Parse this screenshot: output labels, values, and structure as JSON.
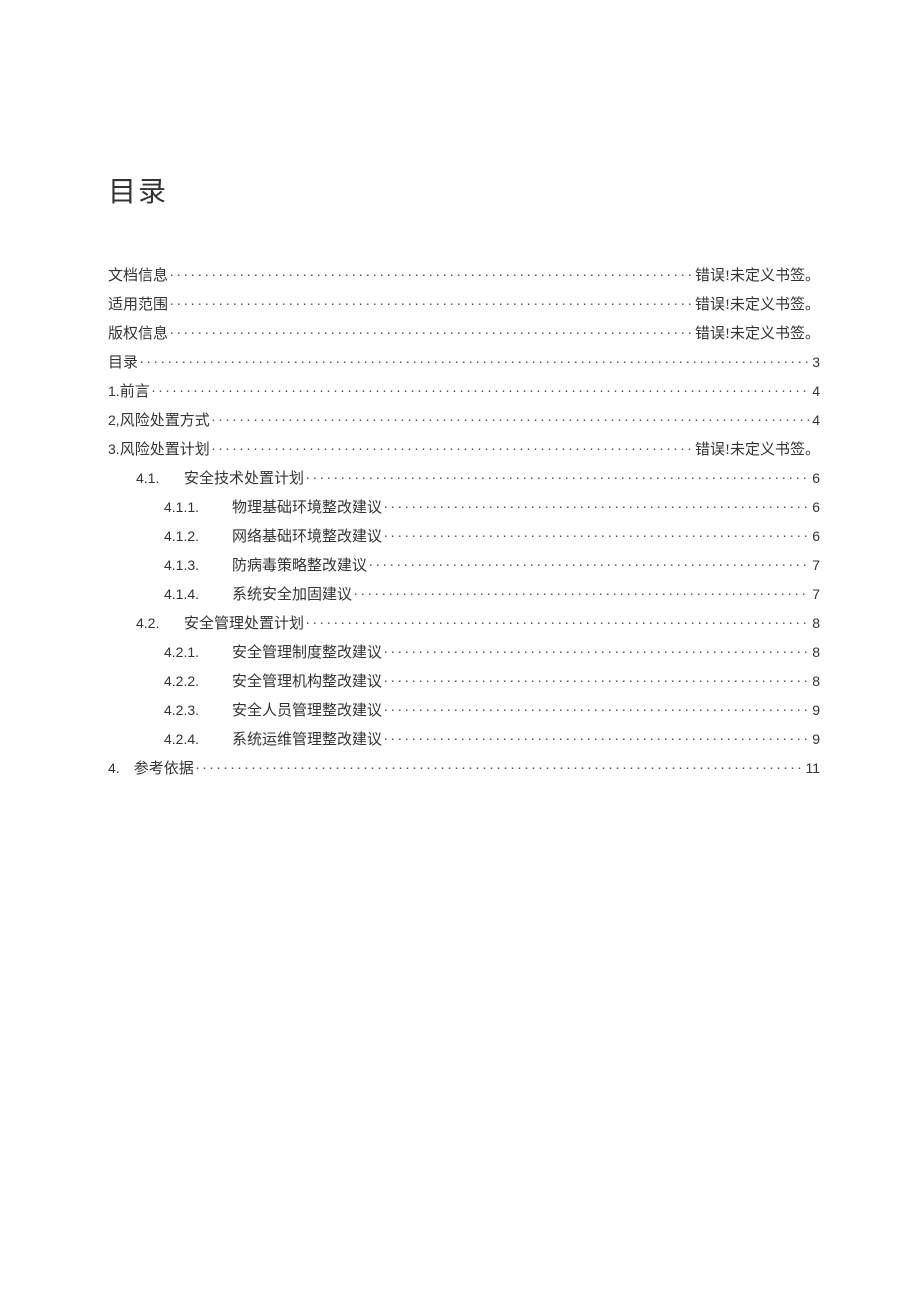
{
  "title": "目录",
  "error_text": "错误!未定义书签。",
  "toc": [
    {
      "level": 0,
      "num": "",
      "text": "文档信息",
      "page": "ERR"
    },
    {
      "level": 0,
      "num": "",
      "text": "适用范围",
      "page": "ERR"
    },
    {
      "level": 0,
      "num": "",
      "text": "版权信息",
      "page": "ERR"
    },
    {
      "level": 0,
      "num": "",
      "text": "目录",
      "page": "3"
    },
    {
      "level": 0,
      "num": "1.",
      "text": "前言",
      "page": "4"
    },
    {
      "level": 0,
      "num": "2,",
      "text": "风险处置方式",
      "page": "4"
    },
    {
      "level": 0,
      "num": "3.",
      "text": "风险处置计划",
      "page": "ERR"
    },
    {
      "level": 1,
      "num": "4.1.",
      "text": "安全技术处置计划",
      "page": "6"
    },
    {
      "level": 2,
      "num": "4.1.1.",
      "text": "物理基础环境整改建议",
      "page": "6"
    },
    {
      "level": 2,
      "num": "4.1.2.",
      "text": "网络基础环境整改建议",
      "page": "6"
    },
    {
      "level": 2,
      "num": "4.1.3.",
      "text": "防病毒策略整改建议",
      "page": "7"
    },
    {
      "level": 2,
      "num": "4.1.4.",
      "text": "系统安全加固建议",
      "page": "7"
    },
    {
      "level": 1,
      "num": "4.2.",
      "text": "安全管理处置计划",
      "page": "8"
    },
    {
      "level": 2,
      "num": "4.2.1.",
      "text": "安全管理制度整改建议",
      "page": "8"
    },
    {
      "level": 2,
      "num": "4.2.2.",
      "text": "安全管理机构整改建议",
      "page": "8"
    },
    {
      "level": 2,
      "num": "4.2.3.",
      "text": "安全人员管理整改建议",
      "page": "9"
    },
    {
      "level": 2,
      "num": "4.2.4.",
      "text": "系统运维管理整改建议",
      "page": "9"
    },
    {
      "level": 0,
      "num": "4.",
      "text": "参考依据",
      "page": "11",
      "num_spaced": true
    }
  ]
}
